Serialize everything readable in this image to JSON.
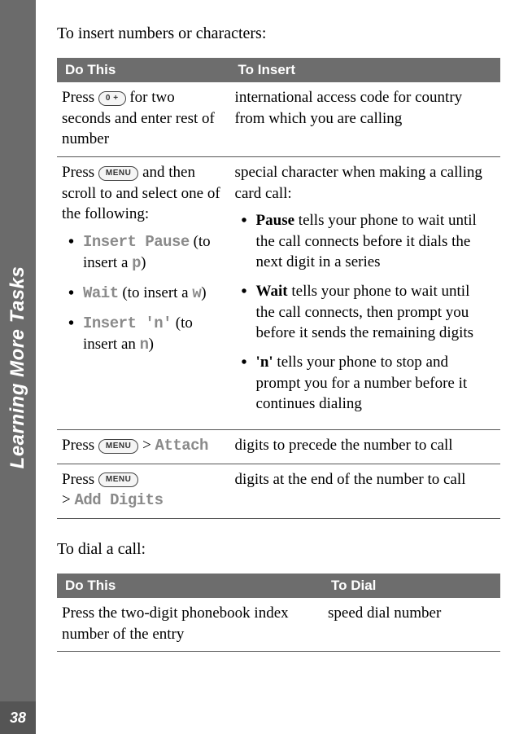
{
  "sidebar": {
    "title": "Learning More Tasks",
    "page_number": "38"
  },
  "intro1": "To insert numbers or characters:",
  "table1": {
    "head": {
      "c1": "Do This",
      "c2": "To Insert"
    },
    "row1": {
      "left_pre": "Press ",
      "key": "0 +",
      "left_post": " for two seconds and enter rest of number",
      "right": "international access code for country from which you are calling"
    },
    "row2": {
      "left_pre": "Press ",
      "key": "MENU",
      "left_post": " and then scroll to and select one of the following:",
      "items": [
        {
          "menu": "Insert Pause",
          "mid": " (to insert a ",
          "char": "p",
          "end": ")"
        },
        {
          "menu": "Wait",
          "mid": " (to insert a ",
          "char": "w",
          "end": ")"
        },
        {
          "menu": "Insert 'n'",
          "mid": " (to insert an ",
          "char": "n",
          "end": ")"
        }
      ],
      "right_intro": "special character when making a calling card call:",
      "right_items": [
        {
          "term": "Pause",
          "desc": " tells your phone to wait until the call connects before it dials the next digit in a series"
        },
        {
          "term": "Wait",
          "desc": " tells your phone to wait until the call connects, then prompt you before it sends the remaining digits"
        },
        {
          "term": "'n'",
          "desc": " tells your phone to stop and prompt you for a number before it continues dialing"
        }
      ]
    },
    "row3": {
      "left_pre": "Press ",
      "key": "MENU",
      "gt": " > ",
      "menu": "Attach",
      "right": "digits to precede the number to call"
    },
    "row4": {
      "left_pre": "Press ",
      "key": "MENU",
      "gt": "> ",
      "menu": "Add Digits",
      "right": "digits at the end of the number to call"
    }
  },
  "intro2": "To dial a call:",
  "table2": {
    "head": {
      "c1": "Do This",
      "c2": "To Dial"
    },
    "row1": {
      "left": "Press the two-digit phonebook index number of the entry",
      "right": "speed dial number"
    }
  }
}
